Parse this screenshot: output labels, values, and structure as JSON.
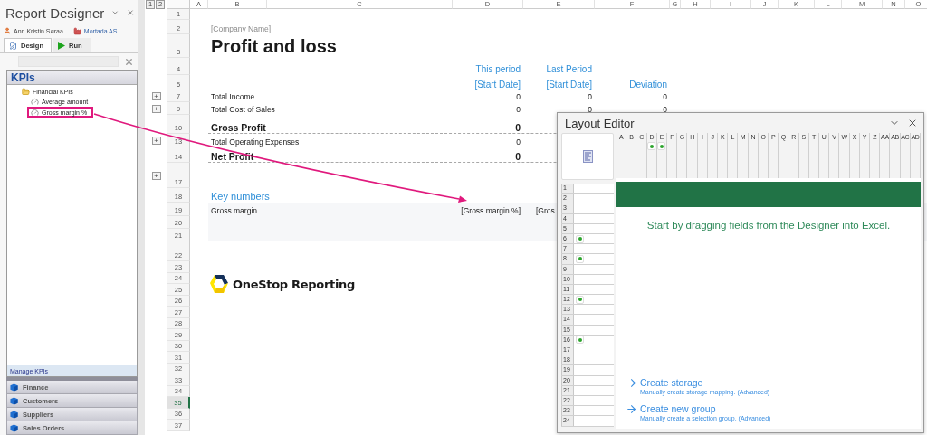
{
  "designer": {
    "title": "Report Designer",
    "user": "Ann Kristin Søraa",
    "company": "Mortada AS",
    "tabs": [
      {
        "label": "Design",
        "kind": "design",
        "selected": true
      },
      {
        "label": "Run",
        "kind": "run",
        "selected": false
      }
    ],
    "kpi_panel": {
      "title": "KPIs",
      "tree": [
        {
          "label": "Financial KPIs",
          "expanded": true,
          "children": [
            {
              "label": "Average amount",
              "highlighted": false
            },
            {
              "label": "Gross margin %",
              "highlighted": true
            }
          ]
        }
      ],
      "footer": "Manage KPIs"
    },
    "sections": [
      "Finance",
      "Customers",
      "Suppliers",
      "Sales Orders"
    ]
  },
  "sheet": {
    "outline_levels": [
      "1",
      "2"
    ],
    "columns": [
      "A",
      "B",
      "C",
      "D",
      "E",
      "F",
      "G",
      "H",
      "I",
      "J",
      "K",
      "L",
      "M",
      "N",
      "O"
    ],
    "rows": [
      {
        "number": "1",
        "kind": "blank",
        "selected": false
      },
      {
        "number": "2",
        "kind": "company",
        "selected": false,
        "label": "[Company Name]"
      },
      {
        "number": "3",
        "kind": "title",
        "selected": false,
        "label": "Profit and loss"
      },
      {
        "number": "4",
        "kind": "period_headers",
        "selected": false,
        "this_period": "This period",
        "last_period": "Last Period"
      },
      {
        "number": "5",
        "kind": "date_headers",
        "selected": false,
        "this_period": "[Start Date]",
        "last_period": "[Start Date]",
        "deviation": "Deviation"
      },
      {
        "number": "7",
        "kind": "line",
        "outline": "+",
        "selected": false,
        "label": "Total Income",
        "this_period": "0",
        "last_period": "0",
        "deviation": "0"
      },
      {
        "number": "9",
        "kind": "line",
        "outline": "+",
        "selected": false,
        "label": "Total Cost of Sales",
        "this_period": "0",
        "last_period": "0",
        "deviation": "0"
      },
      {
        "number": "10",
        "kind": "total",
        "selected": false,
        "label": "Gross Profit",
        "this_period": "0"
      },
      {
        "number": "13",
        "kind": "expense_line",
        "outline": "+",
        "selected": false,
        "label": "Total Operating Expenses",
        "this_period": "0"
      },
      {
        "number": "14",
        "kind": "total",
        "selected": false,
        "label": "Net Profit",
        "this_period": "0"
      },
      {
        "number": "17",
        "kind": "blank",
        "outline": "+",
        "selected": false
      },
      {
        "number": "18",
        "kind": "section",
        "selected": false,
        "label": "Key numbers"
      },
      {
        "number": "19",
        "kind": "key_number",
        "selected": false,
        "label": "Gross margin",
        "this_period": "[Gross margin %]",
        "last_period": "[Gros"
      },
      {
        "number": "20",
        "kind": "band",
        "selected": false
      },
      {
        "number": "21",
        "kind": "band",
        "selected": false
      },
      {
        "number": "22",
        "kind": "blank",
        "selected": false
      },
      {
        "number": "23",
        "kind": "blank",
        "selected": false
      },
      {
        "number": "24",
        "kind": "logo",
        "selected": false,
        "label": "OneStop Reporting"
      },
      {
        "number": "25",
        "kind": "blank",
        "selected": false
      },
      {
        "number": "26",
        "kind": "blank",
        "selected": false
      },
      {
        "number": "27",
        "kind": "blank",
        "selected": false
      },
      {
        "number": "28",
        "kind": "blank",
        "selected": false
      },
      {
        "number": "29",
        "kind": "blank",
        "selected": false
      },
      {
        "number": "30",
        "kind": "blank",
        "selected": false
      },
      {
        "number": "31",
        "kind": "blank",
        "selected": false
      },
      {
        "number": "32",
        "kind": "blank",
        "selected": false
      },
      {
        "number": "33",
        "kind": "blank",
        "selected": false
      },
      {
        "number": "34",
        "kind": "blank",
        "selected": false
      },
      {
        "number": "35",
        "kind": "blank",
        "selected": true
      },
      {
        "number": "36",
        "kind": "blank",
        "selected": false
      },
      {
        "number": "37",
        "kind": "blank",
        "selected": false
      }
    ]
  },
  "layout_editor": {
    "title": "Layout Editor",
    "columns": [
      {
        "label": "A",
        "marked": false
      },
      {
        "label": "B",
        "marked": false
      },
      {
        "label": "C",
        "marked": false
      },
      {
        "label": "D",
        "marked": true
      },
      {
        "label": "E",
        "marked": true
      },
      {
        "label": "F",
        "marked": false
      },
      {
        "label": "G",
        "marked": false
      },
      {
        "label": "H",
        "marked": false
      },
      {
        "label": "I",
        "marked": false
      },
      {
        "label": "J",
        "marked": false
      },
      {
        "label": "K",
        "marked": false
      },
      {
        "label": "L",
        "marked": false
      },
      {
        "label": "M",
        "marked": false
      },
      {
        "label": "N",
        "marked": false
      },
      {
        "label": "O",
        "marked": false
      },
      {
        "label": "P",
        "marked": false
      },
      {
        "label": "Q",
        "marked": false
      },
      {
        "label": "R",
        "marked": false
      },
      {
        "label": "S",
        "marked": false
      },
      {
        "label": "T",
        "marked": false
      },
      {
        "label": "U",
        "marked": false
      },
      {
        "label": "V",
        "marked": false
      },
      {
        "label": "W",
        "marked": false
      },
      {
        "label": "X",
        "marked": false
      },
      {
        "label": "Y",
        "marked": false
      },
      {
        "label": "Z",
        "marked": false
      },
      {
        "label": "AA",
        "marked": false
      },
      {
        "label": "AB",
        "marked": false
      },
      {
        "label": "AC",
        "marked": false
      },
      {
        "label": "AD",
        "marked": false
      }
    ],
    "rows": [
      {
        "label": "1",
        "marked": false
      },
      {
        "label": "2",
        "marked": false
      },
      {
        "label": "3",
        "marked": false
      },
      {
        "label": "4",
        "marked": false
      },
      {
        "label": "5",
        "marked": false
      },
      {
        "label": "6",
        "marked": true
      },
      {
        "label": "7",
        "marked": false
      },
      {
        "label": "8",
        "marked": true
      },
      {
        "label": "9",
        "marked": false
      },
      {
        "label": "10",
        "marked": false
      },
      {
        "label": "11",
        "marked": false
      },
      {
        "label": "12",
        "marked": true
      },
      {
        "label": "13",
        "marked": false
      },
      {
        "label": "14",
        "marked": false
      },
      {
        "label": "15",
        "marked": false
      },
      {
        "label": "16",
        "marked": true
      },
      {
        "label": "17",
        "marked": false
      },
      {
        "label": "18",
        "marked": false
      },
      {
        "label": "19",
        "marked": false
      },
      {
        "label": "20",
        "marked": false
      },
      {
        "label": "21",
        "marked": false
      },
      {
        "label": "22",
        "marked": false
      },
      {
        "label": "23",
        "marked": false
      },
      {
        "label": "24",
        "marked": false
      }
    ],
    "message": "Start by dragging fields from the Designer into Excel.",
    "actions": [
      {
        "title": "Create storage",
        "description": "Manually create storage mapping. (Advanced)"
      },
      {
        "title": "Create new group",
        "description": "Manually create a selection group. (Advanced)"
      }
    ]
  }
}
